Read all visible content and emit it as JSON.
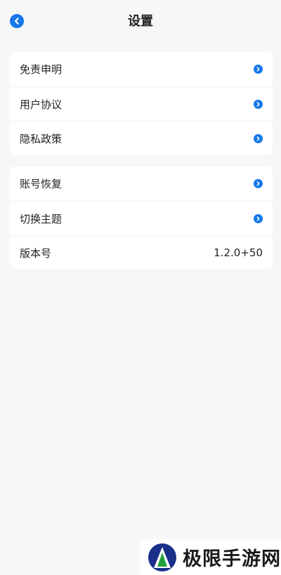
{
  "header": {
    "title": "设置",
    "back_icon": "chevron-left-icon"
  },
  "colors": {
    "accent": "#1677e8",
    "background": "#f7f7f7",
    "card": "#ffffff"
  },
  "section1": {
    "items": [
      {
        "label": "免责申明",
        "icon": "chevron-right-icon"
      },
      {
        "label": "用户协议",
        "icon": "chevron-right-icon"
      },
      {
        "label": "隐私政策",
        "icon": "chevron-right-icon"
      }
    ]
  },
  "section2": {
    "items": [
      {
        "label": "账号恢复",
        "icon": "chevron-right-icon"
      },
      {
        "label": "切换主题",
        "icon": "chevron-right-icon"
      },
      {
        "label": "版本号",
        "value": "1.2.0+50"
      }
    ]
  },
  "watermark": {
    "text": "极限手游网"
  }
}
